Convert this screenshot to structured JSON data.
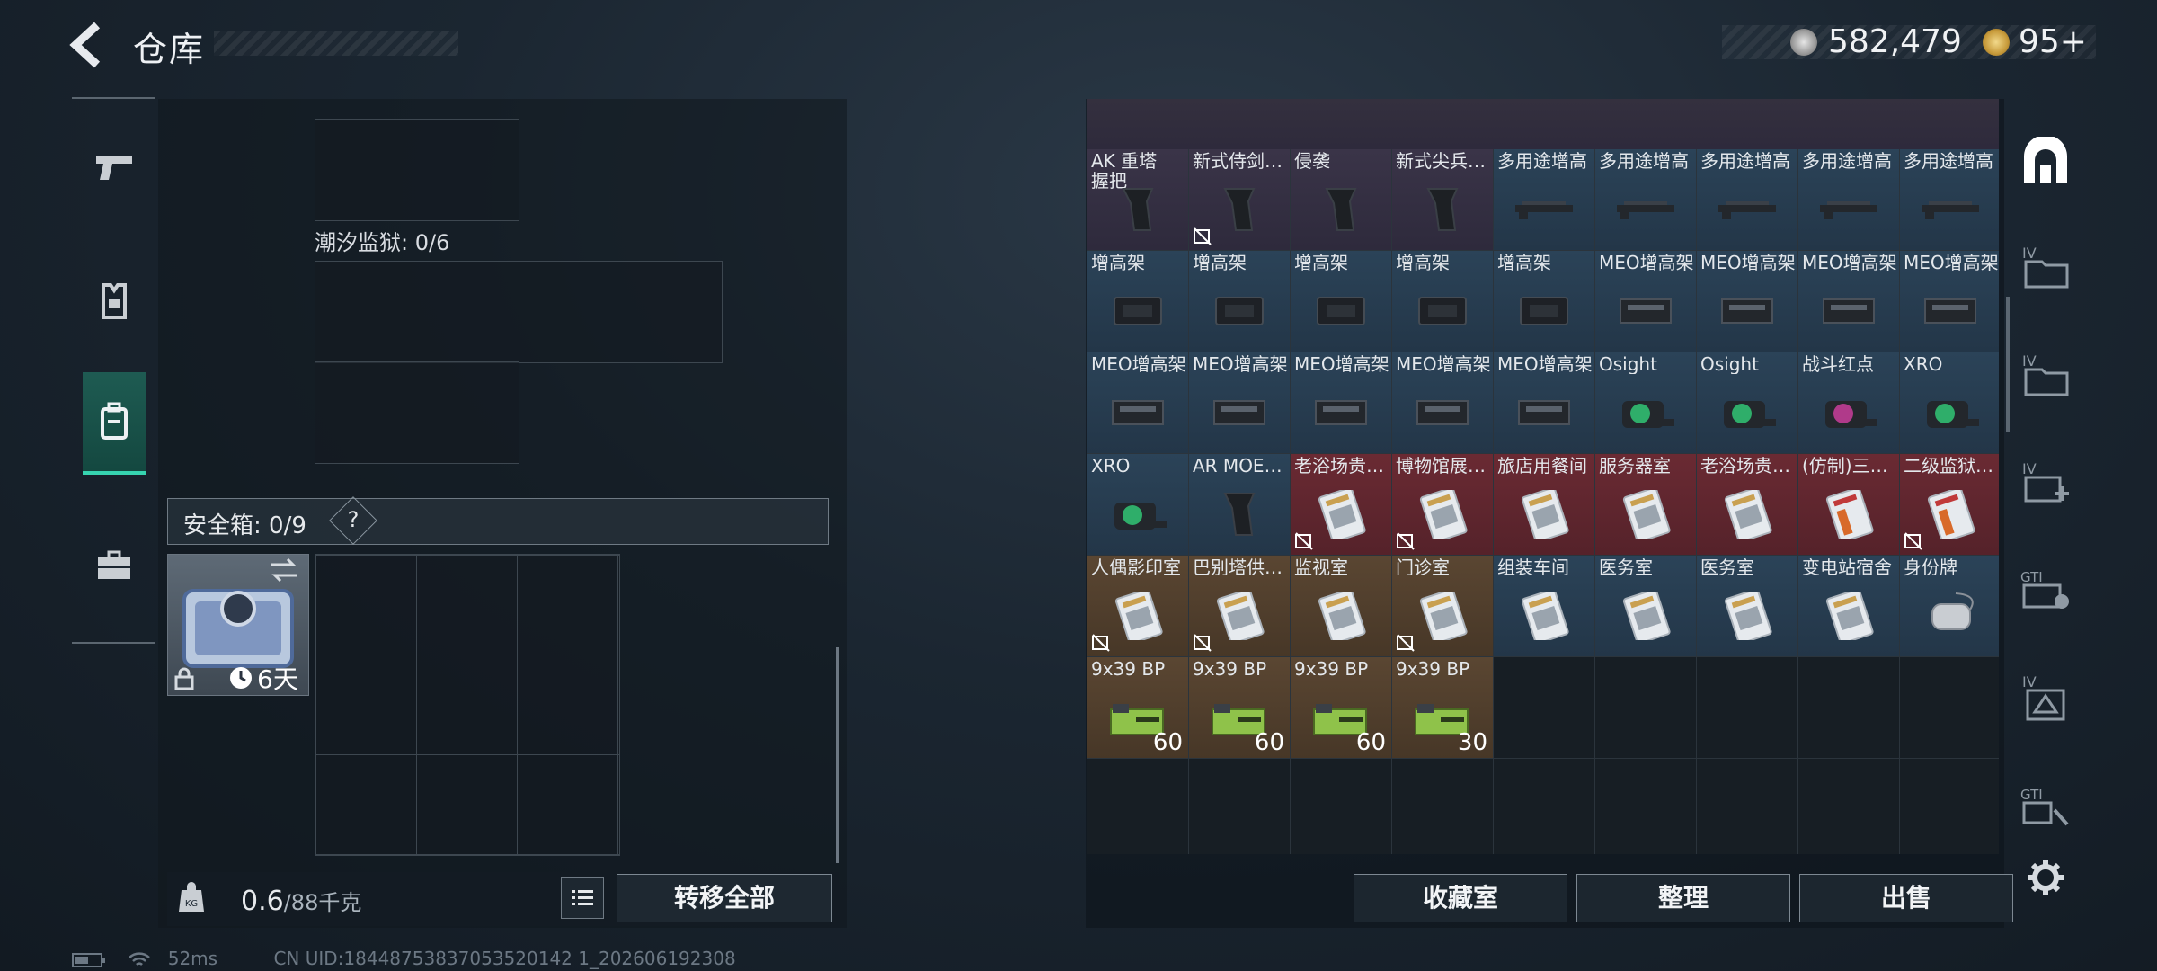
{
  "header": {
    "title": "仓库",
    "money": "582,479",
    "premium": "95+"
  },
  "left_nav": {
    "items": [
      {
        "name": "weapons-tab",
        "icon": "pistol-icon"
      },
      {
        "name": "gear-tab",
        "icon": "vest-icon"
      },
      {
        "name": "backpack-tab",
        "icon": "backpack-icon",
        "active": true
      },
      {
        "name": "items-tab",
        "icon": "toolbox-icon"
      }
    ]
  },
  "left_panel": {
    "section_label": "潮汐监狱: 0/6",
    "safe_label": "安全箱: 0/9",
    "safe_help": "?",
    "safe_days": "6天",
    "weight": "0.6",
    "weight_max": "/88千克",
    "transfer_all": "转移全部"
  },
  "stash": {
    "rows": [
      [
        {
          "label": "AK 重塔握把",
          "color": "purple",
          "art": "grip"
        },
        {
          "label": "新式侍剑…",
          "color": "purple",
          "art": "grip",
          "nodrop": true
        },
        {
          "label": "侵袭",
          "color": "purple",
          "art": "grip"
        },
        {
          "label": "新式尖兵…",
          "color": "purple",
          "art": "grip"
        },
        {
          "label": "多用途增高",
          "color": "blue",
          "art": "rail"
        },
        {
          "label": "多用途增高",
          "color": "blue",
          "art": "rail"
        },
        {
          "label": "多用途增高",
          "color": "blue",
          "art": "rail"
        },
        {
          "label": "多用途增高",
          "color": "blue",
          "art": "rail"
        },
        {
          "label": "多用途增高",
          "color": "blue",
          "art": "rail"
        }
      ],
      [
        {
          "label": "增高架",
          "color": "blue",
          "art": "mount"
        },
        {
          "label": "增高架",
          "color": "blue",
          "art": "mount"
        },
        {
          "label": "增高架",
          "color": "blue",
          "art": "mount"
        },
        {
          "label": "增高架",
          "color": "blue",
          "art": "mount"
        },
        {
          "label": "增高架",
          "color": "blue",
          "art": "mount"
        },
        {
          "label": "MEO增高架",
          "color": "blue",
          "art": "meo"
        },
        {
          "label": "MEO增高架",
          "color": "blue",
          "art": "meo"
        },
        {
          "label": "MEO增高架",
          "color": "blue",
          "art": "meo"
        },
        {
          "label": "MEO增高架",
          "color": "blue",
          "art": "meo"
        }
      ],
      [
        {
          "label": "MEO增高架",
          "color": "blue",
          "art": "meo"
        },
        {
          "label": "MEO增高架",
          "color": "blue",
          "art": "meo"
        },
        {
          "label": "MEO增高架",
          "color": "blue",
          "art": "meo"
        },
        {
          "label": "MEO增高架",
          "color": "blue",
          "art": "meo"
        },
        {
          "label": "MEO增高架",
          "color": "blue",
          "art": "meo"
        },
        {
          "label": "Osight",
          "color": "blue",
          "art": "sight-green"
        },
        {
          "label": "Osight",
          "color": "blue",
          "art": "sight-green"
        },
        {
          "label": "战斗红点",
          "color": "blue",
          "art": "sight-red"
        },
        {
          "label": "XRO",
          "color": "blue",
          "art": "sight-green"
        }
      ],
      [
        {
          "label": "XRO",
          "color": "blue",
          "art": "sight-green"
        },
        {
          "label": "AR MOE…",
          "color": "blue",
          "art": "grip"
        },
        {
          "label": "老浴场贵…",
          "color": "red",
          "art": "card",
          "nodrop": true
        },
        {
          "label": "博物馆展…",
          "color": "red",
          "art": "card",
          "nodrop": true
        },
        {
          "label": "旅店用餐间",
          "color": "red",
          "art": "card"
        },
        {
          "label": "服务器室",
          "color": "red",
          "art": "card"
        },
        {
          "label": "老浴场贵…",
          "color": "red",
          "art": "card"
        },
        {
          "label": "(仿制)三…",
          "color": "red",
          "art": "card-red"
        },
        {
          "label": "二级监狱…",
          "color": "red",
          "art": "card-red",
          "nodrop": true
        }
      ],
      [
        {
          "label": "人偶影印室",
          "color": "gold",
          "art": "card",
          "nodrop": true
        },
        {
          "label": "巴别塔供…",
          "color": "gold",
          "art": "card",
          "nodrop": true
        },
        {
          "label": "监视室",
          "color": "gold",
          "art": "card"
        },
        {
          "label": "门诊室",
          "color": "gold",
          "art": "card",
          "nodrop": true
        },
        {
          "label": "组装车间",
          "color": "blue",
          "art": "card"
        },
        {
          "label": "医务室",
          "color": "blue",
          "art": "card"
        },
        {
          "label": "医务室",
          "color": "blue",
          "art": "card"
        },
        {
          "label": "变电站宿舍",
          "color": "blue",
          "art": "card"
        },
        {
          "label": "身份牌",
          "color": "blue",
          "art": "tag"
        }
      ],
      [
        {
          "label": "9x39 BP",
          "color": "gold",
          "art": "ammo",
          "qty": "60"
        },
        {
          "label": "9x39 BP",
          "color": "gold",
          "art": "ammo",
          "qty": "60"
        },
        {
          "label": "9x39 BP",
          "color": "gold",
          "art": "ammo",
          "qty": "60"
        },
        {
          "label": "9x39 BP",
          "color": "gold",
          "art": "ammo",
          "qty": "30"
        },
        {
          "label": "",
          "color": "empty"
        },
        {
          "label": "",
          "color": "empty"
        },
        {
          "label": "",
          "color": "empty"
        },
        {
          "label": "",
          "color": "empty"
        },
        {
          "label": "",
          "color": "empty"
        }
      ],
      [
        {
          "label": "",
          "color": "empty"
        },
        {
          "label": "",
          "color": "empty"
        },
        {
          "label": "",
          "color": "empty"
        },
        {
          "label": "",
          "color": "empty"
        },
        {
          "label": "",
          "color": "empty"
        },
        {
          "label": "",
          "color": "empty"
        },
        {
          "label": "",
          "color": "empty"
        },
        {
          "label": "",
          "color": "empty"
        },
        {
          "label": "",
          "color": "empty"
        }
      ]
    ],
    "buttons": {
      "collection": "收藏室",
      "sort": "整理",
      "sell": "出售"
    }
  },
  "right_nav": {
    "items": [
      {
        "name": "home-tab",
        "icon": "hideout-icon"
      },
      {
        "name": "cat1",
        "icon": "folder-icon"
      },
      {
        "name": "cat2",
        "icon": "folder-icon"
      },
      {
        "name": "cat3",
        "icon": "medkit-icon"
      },
      {
        "name": "cat4",
        "icon": "gti-icon"
      },
      {
        "name": "cat5",
        "icon": "armor-icon"
      },
      {
        "name": "cat6",
        "icon": "gti-icon"
      }
    ]
  },
  "status": {
    "ping": "52ms",
    "uid": "CN UID:18448753837053520142 1_202606192308"
  },
  "colors": {
    "accent": "#36d4b0",
    "blue_rarity": "#2b4358",
    "purple_rarity": "#3a3448",
    "red_rarity": "#6a2a33",
    "gold_rarity": "#5a4632"
  }
}
